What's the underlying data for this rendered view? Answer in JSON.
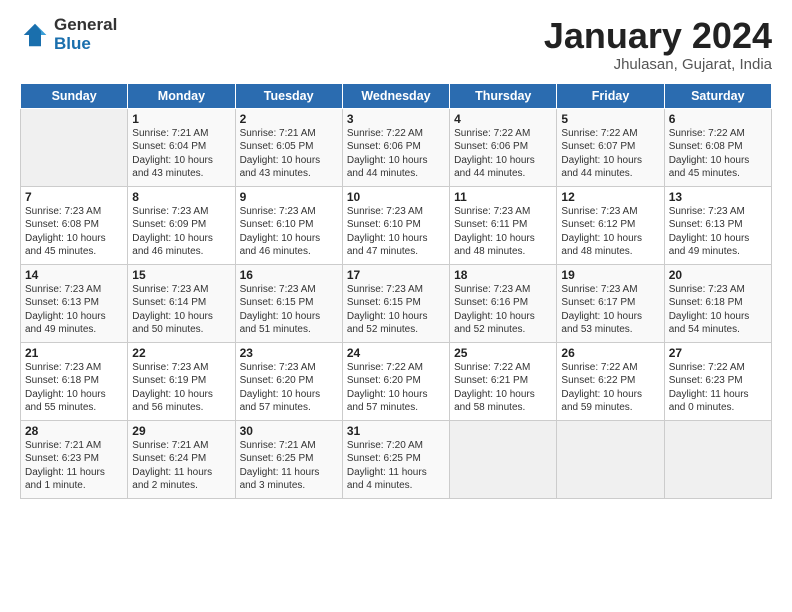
{
  "header": {
    "logo_general": "General",
    "logo_blue": "Blue",
    "title": "January 2024",
    "location": "Jhulasan, Gujarat, India"
  },
  "days_of_week": [
    "Sunday",
    "Monday",
    "Tuesday",
    "Wednesday",
    "Thursday",
    "Friday",
    "Saturday"
  ],
  "weeks": [
    [
      {
        "day": "",
        "info": ""
      },
      {
        "day": "1",
        "info": "Sunrise: 7:21 AM\nSunset: 6:04 PM\nDaylight: 10 hours\nand 43 minutes."
      },
      {
        "day": "2",
        "info": "Sunrise: 7:21 AM\nSunset: 6:05 PM\nDaylight: 10 hours\nand 43 minutes."
      },
      {
        "day": "3",
        "info": "Sunrise: 7:22 AM\nSunset: 6:06 PM\nDaylight: 10 hours\nand 44 minutes."
      },
      {
        "day": "4",
        "info": "Sunrise: 7:22 AM\nSunset: 6:06 PM\nDaylight: 10 hours\nand 44 minutes."
      },
      {
        "day": "5",
        "info": "Sunrise: 7:22 AM\nSunset: 6:07 PM\nDaylight: 10 hours\nand 44 minutes."
      },
      {
        "day": "6",
        "info": "Sunrise: 7:22 AM\nSunset: 6:08 PM\nDaylight: 10 hours\nand 45 minutes."
      }
    ],
    [
      {
        "day": "7",
        "info": "Sunrise: 7:23 AM\nSunset: 6:08 PM\nDaylight: 10 hours\nand 45 minutes."
      },
      {
        "day": "8",
        "info": "Sunrise: 7:23 AM\nSunset: 6:09 PM\nDaylight: 10 hours\nand 46 minutes."
      },
      {
        "day": "9",
        "info": "Sunrise: 7:23 AM\nSunset: 6:10 PM\nDaylight: 10 hours\nand 46 minutes."
      },
      {
        "day": "10",
        "info": "Sunrise: 7:23 AM\nSunset: 6:10 PM\nDaylight: 10 hours\nand 47 minutes."
      },
      {
        "day": "11",
        "info": "Sunrise: 7:23 AM\nSunset: 6:11 PM\nDaylight: 10 hours\nand 48 minutes."
      },
      {
        "day": "12",
        "info": "Sunrise: 7:23 AM\nSunset: 6:12 PM\nDaylight: 10 hours\nand 48 minutes."
      },
      {
        "day": "13",
        "info": "Sunrise: 7:23 AM\nSunset: 6:13 PM\nDaylight: 10 hours\nand 49 minutes."
      }
    ],
    [
      {
        "day": "14",
        "info": "Sunrise: 7:23 AM\nSunset: 6:13 PM\nDaylight: 10 hours\nand 49 minutes."
      },
      {
        "day": "15",
        "info": "Sunrise: 7:23 AM\nSunset: 6:14 PM\nDaylight: 10 hours\nand 50 minutes."
      },
      {
        "day": "16",
        "info": "Sunrise: 7:23 AM\nSunset: 6:15 PM\nDaylight: 10 hours\nand 51 minutes."
      },
      {
        "day": "17",
        "info": "Sunrise: 7:23 AM\nSunset: 6:15 PM\nDaylight: 10 hours\nand 52 minutes."
      },
      {
        "day": "18",
        "info": "Sunrise: 7:23 AM\nSunset: 6:16 PM\nDaylight: 10 hours\nand 52 minutes."
      },
      {
        "day": "19",
        "info": "Sunrise: 7:23 AM\nSunset: 6:17 PM\nDaylight: 10 hours\nand 53 minutes."
      },
      {
        "day": "20",
        "info": "Sunrise: 7:23 AM\nSunset: 6:18 PM\nDaylight: 10 hours\nand 54 minutes."
      }
    ],
    [
      {
        "day": "21",
        "info": "Sunrise: 7:23 AM\nSunset: 6:18 PM\nDaylight: 10 hours\nand 55 minutes."
      },
      {
        "day": "22",
        "info": "Sunrise: 7:23 AM\nSunset: 6:19 PM\nDaylight: 10 hours\nand 56 minutes."
      },
      {
        "day": "23",
        "info": "Sunrise: 7:23 AM\nSunset: 6:20 PM\nDaylight: 10 hours\nand 57 minutes."
      },
      {
        "day": "24",
        "info": "Sunrise: 7:22 AM\nSunset: 6:20 PM\nDaylight: 10 hours\nand 57 minutes."
      },
      {
        "day": "25",
        "info": "Sunrise: 7:22 AM\nSunset: 6:21 PM\nDaylight: 10 hours\nand 58 minutes."
      },
      {
        "day": "26",
        "info": "Sunrise: 7:22 AM\nSunset: 6:22 PM\nDaylight: 10 hours\nand 59 minutes."
      },
      {
        "day": "27",
        "info": "Sunrise: 7:22 AM\nSunset: 6:23 PM\nDaylight: 11 hours\nand 0 minutes."
      }
    ],
    [
      {
        "day": "28",
        "info": "Sunrise: 7:21 AM\nSunset: 6:23 PM\nDaylight: 11 hours\nand 1 minute."
      },
      {
        "day": "29",
        "info": "Sunrise: 7:21 AM\nSunset: 6:24 PM\nDaylight: 11 hours\nand 2 minutes."
      },
      {
        "day": "30",
        "info": "Sunrise: 7:21 AM\nSunset: 6:25 PM\nDaylight: 11 hours\nand 3 minutes."
      },
      {
        "day": "31",
        "info": "Sunrise: 7:20 AM\nSunset: 6:25 PM\nDaylight: 11 hours\nand 4 minutes."
      },
      {
        "day": "",
        "info": ""
      },
      {
        "day": "",
        "info": ""
      },
      {
        "day": "",
        "info": ""
      }
    ]
  ]
}
